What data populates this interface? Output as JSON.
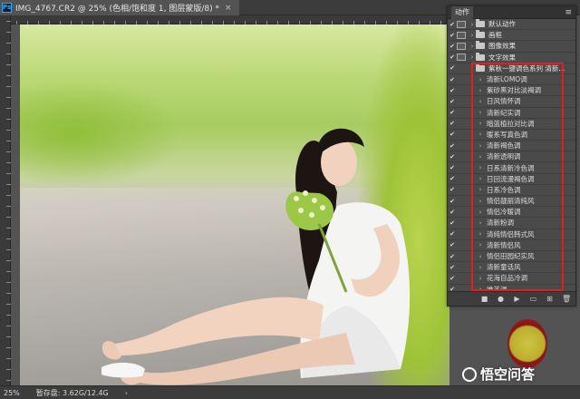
{
  "document": {
    "tab_title": "IMG_4767.CR2 @ 25% (色相/饱和度 1, 图层蒙版/8) *",
    "close_glyph": "×",
    "app_icon_label": "Ps"
  },
  "actions_panel": {
    "tab_label": "动作",
    "menu_glyph": "≡",
    "sets": [
      {
        "label": "默认动作",
        "checked": "✔"
      },
      {
        "label": "画框",
        "checked": "✔"
      },
      {
        "label": "图像效果",
        "checked": "✔"
      },
      {
        "label": "文字效果",
        "checked": "✔"
      },
      {
        "label": "紫秋一键调色系列 清新...",
        "checked": "✔"
      }
    ],
    "actions": [
      "清新LOMO调",
      "紫砂黑对比淡褐调",
      "日风情怀调",
      "清新纪实调",
      "暗蓝植拉对比调",
      "暖系写真色调",
      "清新褐色调",
      "清新透明调",
      "日系清新冷色调",
      "日回流漫褐色调",
      "日系冷色调",
      "情侣靓丽清纯风",
      "情侣冷暖调",
      "清新粉调",
      "清纯情侣韩式风",
      "清新情侣风",
      "情侣田园纪实风",
      "清新童话风",
      "花海自品冷调",
      "唯美调"
    ],
    "action_check": "✔",
    "arrow_glyph": "›",
    "footer_buttons": [
      {
        "name": "stop",
        "glyph": "■"
      },
      {
        "name": "record",
        "glyph": "●"
      },
      {
        "name": "play",
        "glyph": "▶"
      },
      {
        "name": "new-set",
        "glyph": "▭"
      },
      {
        "name": "new-action",
        "glyph": "⊞"
      },
      {
        "name": "delete",
        "glyph": "🗑"
      }
    ]
  },
  "statusbar": {
    "zoom": "25%",
    "doc_info": "暂存盘: 3.62G/12.4G",
    "arrow": "›"
  },
  "watermark": {
    "text": "悟空问答"
  },
  "colors": {
    "accent_box": "#e02020",
    "ps_blue": "#31a8ff",
    "panel_bg": "#4a4a4a"
  }
}
